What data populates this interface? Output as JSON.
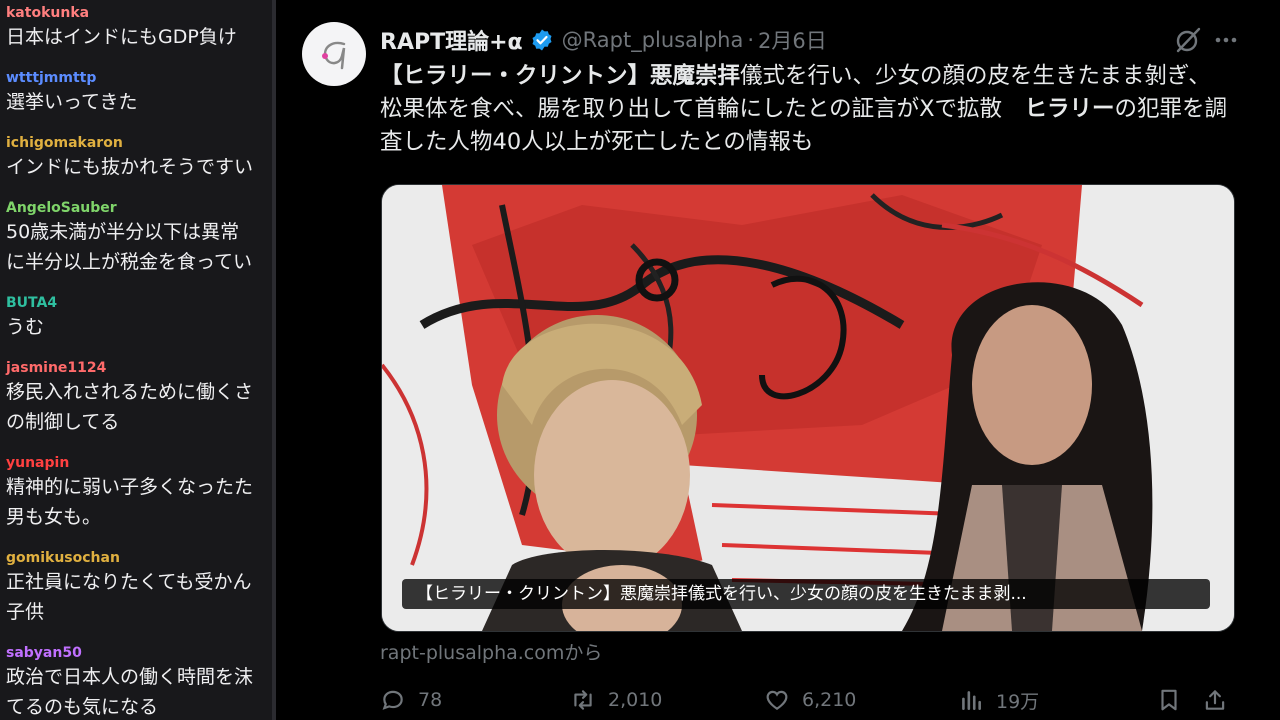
{
  "chat": {
    "messages": [
      {
        "user": "katokunka",
        "color": "#ff7f7f",
        "text": "日本はインドにもGDP負け"
      },
      {
        "user": "wtttjmmttp",
        "color": "#5b8cff",
        "text": "選挙いってきた"
      },
      {
        "user": "ichigomakaron",
        "color": "#e0b040",
        "text": "インドにも抜かれそうですい"
      },
      {
        "user": "AngeloSauber",
        "color": "#7fd46a",
        "text": "50歳未満が半分以下は異常\nに半分以上が税金を食ってい"
      },
      {
        "user": "BUTA4",
        "color": "#2fbfa0",
        "text": "うむ"
      },
      {
        "user": "jasmine1124",
        "color": "#ff6a6a",
        "text": "移民入れされるために働くさ\nの制御してる"
      },
      {
        "user": "yunapin",
        "color": "#ff4040",
        "text": "精神的に弱い子多くなったた\n男も女も。"
      },
      {
        "user": "gomikusochan",
        "color": "#e0b040",
        "text": "正社員になりたくても受かん\n子供"
      },
      {
        "user": "sabyan50",
        "color": "#c070ff",
        "text": "政治で日本人の働く時間を沫\nてるのも気になる"
      }
    ]
  },
  "tweet": {
    "display_name": "RAPT理論+α",
    "handle": "@Rapt_plusalpha",
    "separator": "·",
    "date": "2月6日",
    "text_bold_1": "【ヒラリー・クリントン】悪魔崇拝",
    "text_1": "儀式を行い、少女の顔の皮を生きたまま剝ぎ、松果体を食べ、腸を取り出して首輪にしたとの証言がXで拡散　",
    "text_bold_2": "ヒラリー",
    "text_2": "の犯罪を調査した人物40人以上が死亡したとの情報も",
    "media_caption": "【ヒラリー・クリントン】悪魔崇拝儀式を行い、少女の顔の皮を生きたまま剥...",
    "link_source": "rapt-plusalpha.comから",
    "stats": {
      "replies": "78",
      "retweets": "2,010",
      "likes": "6,210",
      "views": "19万"
    },
    "colors": {
      "verified": "#1d9bf0",
      "muted": "#71767b",
      "accent_pink": "#e040a0"
    }
  }
}
